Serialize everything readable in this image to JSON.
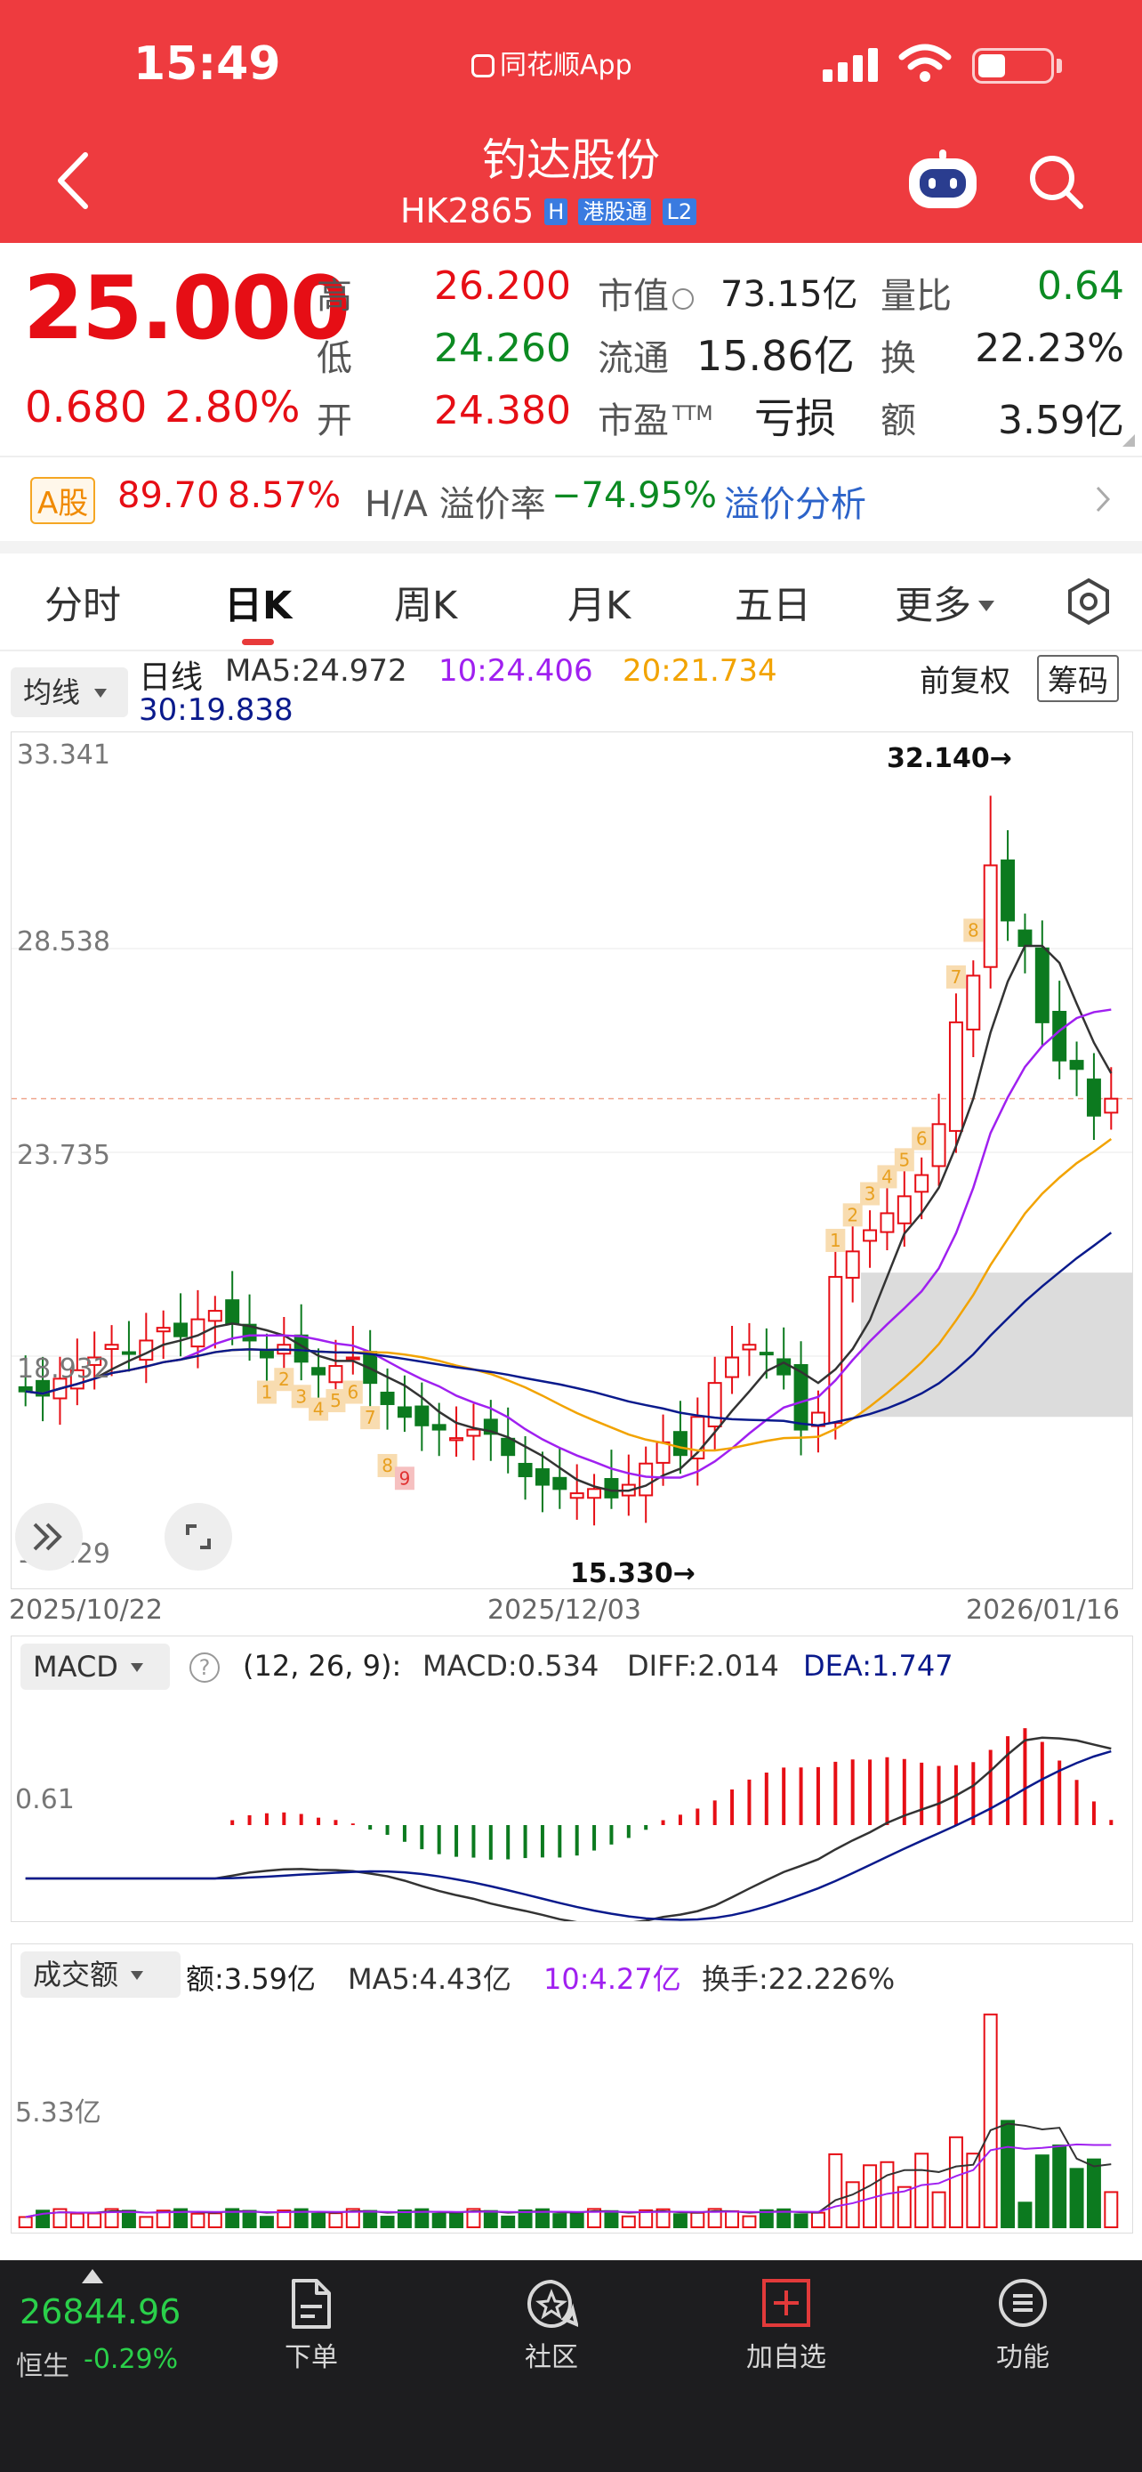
{
  "status_bar": {
    "time": "15:49",
    "app_label": "同花顺App"
  },
  "header": {
    "title": "钓达股份",
    "code": "HK2865",
    "tag_h": "H",
    "tag_connect": "港股通",
    "tag_level": "L2"
  },
  "quote": {
    "price": "25.000",
    "change": "0.680",
    "change_pct": "2.80%",
    "high_label": "高",
    "high": "26.200",
    "low_label": "低",
    "low": "24.260",
    "open_label": "开",
    "open": "24.380",
    "mcap_label": "市值",
    "mcap": "73.15亿",
    "float_label": "流通",
    "float": "15.86亿",
    "pe_label": "市盈",
    "pe_sup": "TTM",
    "pe": "亏损",
    "vr_label": "量比",
    "vr": "0.64",
    "turnover_label": "换",
    "turnover": "22.23%",
    "amount_label": "额",
    "amount": "3.59亿"
  },
  "ah_bar": {
    "a_tag": "A股",
    "a_price": "89.70",
    "a_pct": "8.57%",
    "premium_label": "H/A 溢价率",
    "premium": "−74.95%",
    "link": "溢价分析"
  },
  "tabs": [
    "分时",
    "日K",
    "周K",
    "月K",
    "五日",
    "更多"
  ],
  "active_tab": "日K",
  "ma_bar": {
    "selector": "均线",
    "line_label": "日线",
    "ma5": "MA5:24.972",
    "ma10": "10:24.406",
    "ma20": "20:21.734",
    "ma30": "30:19.838",
    "adjust": "前复权",
    "chip": "筹码"
  },
  "kline": {
    "y_labels": [
      "33.341",
      "28.538",
      "23.735",
      "18.932",
      "14.129"
    ],
    "x_labels": [
      "2025/10/22",
      "2025/12/03",
      "2026/01/16"
    ],
    "high_marker": "32.140→",
    "low_marker": "15.330→",
    "nine_turn_down": [
      "1",
      "2",
      "3",
      "4",
      "5",
      "6",
      "7",
      "8",
      "9"
    ],
    "nine_turn_up": [
      "1",
      "2",
      "3",
      "4",
      "5",
      "6",
      "7",
      "8"
    ],
    "colors": {
      "up": "#e60e15",
      "down": "#0c7a1f",
      "ma5": "#333333",
      "ma10": "#a020f0",
      "ma20": "#f2a300",
      "ma30": "#0a1a8c"
    }
  },
  "macd": {
    "selector": "MACD",
    "params": "(12, 26, 9):",
    "macd": "MACD:0.534",
    "diff": "DIFF:2.014",
    "dea": "DEA:1.747",
    "y_label": "0.61"
  },
  "volume": {
    "selector": "成交额",
    "amount": "额:3.59亿",
    "ma5": "MA5:4.43亿",
    "ma10": "10:4.27亿",
    "turnover": "换手:22.226%",
    "y_label": "5.33亿"
  },
  "chart_data": {
    "type": "candlestick",
    "date_range": [
      "2025/10/22",
      "2026/01/16"
    ],
    "ylim": [
      14.129,
      33.341
    ],
    "y_ticks": [
      33.341,
      28.538,
      23.735,
      18.932,
      14.129
    ],
    "period_high": 32.14,
    "period_low": 15.33,
    "last": {
      "close": 25.0,
      "high": 26.2,
      "low": 24.26,
      "open": 24.38
    },
    "ma": {
      "MA5": 24.972,
      "MA10": 24.406,
      "MA20": 21.734,
      "MA30": 19.838
    },
    "macd": {
      "MACD": 0.534,
      "DIFF": 2.014,
      "DEA": 1.747
    },
    "volume": {
      "amount": "3.59亿",
      "MA5": "4.43亿",
      "MA10": "4.27亿",
      "turnover": "22.226%"
    }
  },
  "bottom_bar": {
    "index_value": "26844.96",
    "index_name": "恒生",
    "index_pct": "-0.29%",
    "items": [
      "下单",
      "社区",
      "加自选",
      "功能"
    ]
  }
}
